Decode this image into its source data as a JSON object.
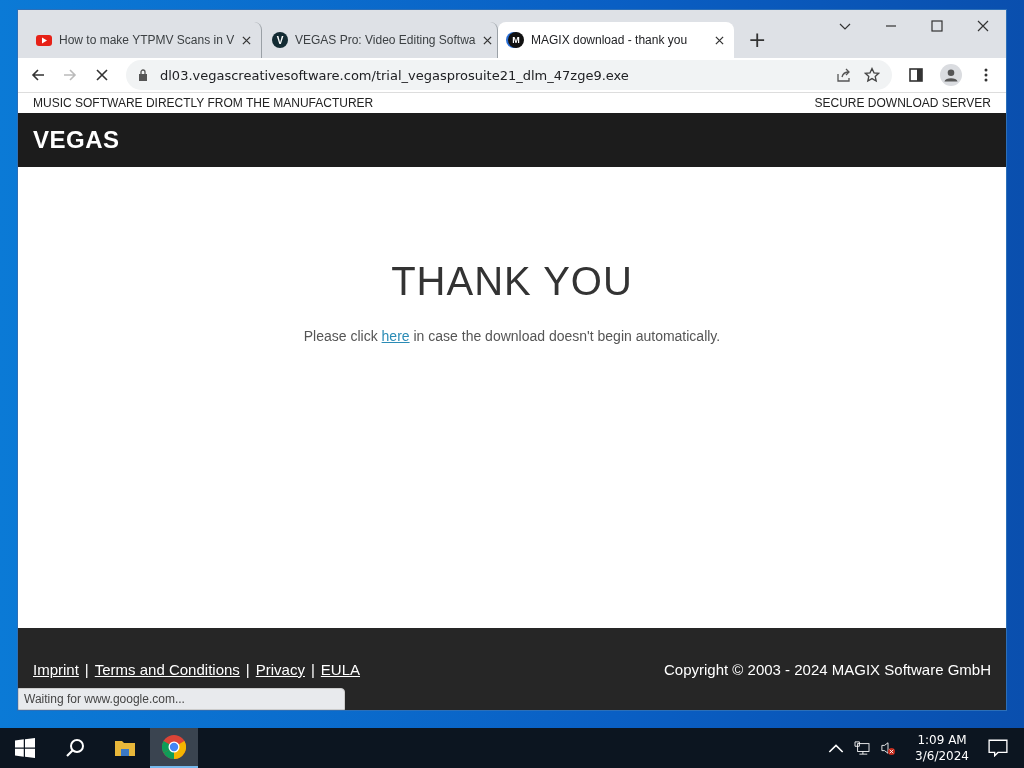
{
  "browser": {
    "tabs": [
      {
        "title": "How to make YTPMV Scans in V",
        "kind": "youtube",
        "selected": false
      },
      {
        "title": "VEGAS Pro: Video Editing Softwa",
        "kind": "letter",
        "letter": "V",
        "selected": false
      },
      {
        "title": "MAGIX download - thank you",
        "kind": "ring",
        "letter": "M",
        "selected": true
      }
    ],
    "new_tab": "+",
    "loading": true,
    "url": "dl03.vegascreativesoftware.com/trial_vegasprosuite21_dlm_47zge9.exe"
  },
  "page": {
    "topbar_left": "MUSIC SOFTWARE DIRECTLY FROM THE MANUFACTURER",
    "topbar_right": "SECURE DOWNLOAD SERVER",
    "logo": "VEGAS",
    "heading": "THANK YOU",
    "hint": {
      "before": "Please click ",
      "link": "here",
      "after": " in case the download doesn't begin automatically."
    },
    "footer": {
      "links": [
        "Imprint",
        "Terms and Conditions",
        "Privacy",
        "EULA"
      ],
      "separator": "|",
      "copyright": "Copyright © 2003 - 2024 MAGIX Software GmbH"
    }
  },
  "status_bubble": "Waiting for www.google.com...",
  "taskbar": {
    "time": "1:09 AM",
    "date": "3/6/2024",
    "sound_muted": true
  }
}
